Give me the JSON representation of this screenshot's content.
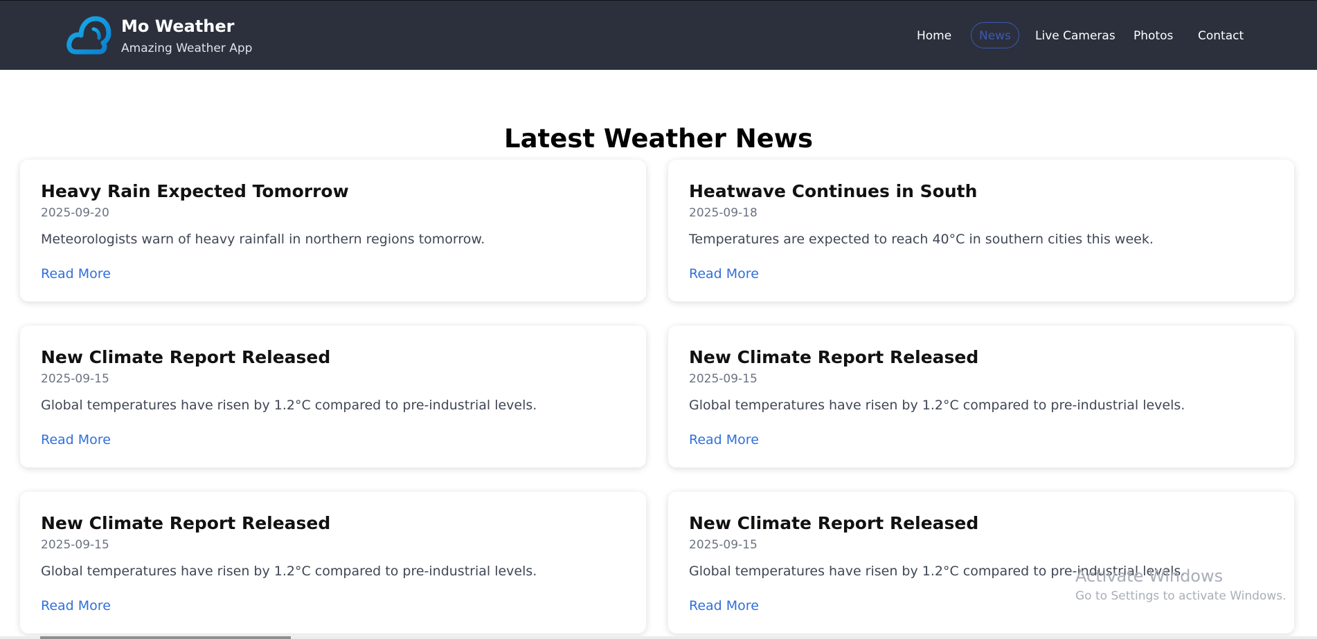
{
  "header": {
    "brand_title": "Mo Weather",
    "brand_subtitle": "Amazing Weather App",
    "logo_icon": "cloud-icon",
    "nav": [
      {
        "label": "Home",
        "active": false
      },
      {
        "label": "News",
        "active": true
      },
      {
        "label": "Live Cameras",
        "active": false
      },
      {
        "label": "Photos",
        "active": false
      },
      {
        "label": "Contact",
        "active": false
      }
    ]
  },
  "main": {
    "heading": "Latest Weather News",
    "articles": [
      {
        "title": "Heavy Rain Expected Tomorrow",
        "date": "2025-09-20",
        "summary": "Meteorologists warn of heavy rainfall in northern regions tomorrow.",
        "link": "Read More"
      },
      {
        "title": "Heatwave Continues in South",
        "date": "2025-09-18",
        "summary": "Temperatures are expected to reach 40°C in southern cities this week.",
        "link": "Read More"
      },
      {
        "title": "New Climate Report Released",
        "date": "2025-09-15",
        "summary": "Global temperatures have risen by 1.2°C compared to pre-industrial levels.",
        "link": "Read More"
      },
      {
        "title": "New Climate Report Released",
        "date": "2025-09-15",
        "summary": "Global temperatures have risen by 1.2°C compared to pre-industrial levels.",
        "link": "Read More"
      },
      {
        "title": "New Climate Report Released",
        "date": "2025-09-15",
        "summary": "Global temperatures have risen by 1.2°C compared to pre-industrial levels.",
        "link": "Read More"
      },
      {
        "title": "New Climate Report Released",
        "date": "2025-09-15",
        "summary": "Global temperatures have risen by 1.2°C compared to pre-industrial levels.",
        "link": "Read More"
      }
    ]
  },
  "overlay": {
    "watermark_title": "Activate Windows",
    "watermark_subtitle": "Go to Settings to activate Windows."
  },
  "colors": {
    "navbar_bg": "#2b303c",
    "active_nav": "#3f58b5",
    "link": "#2f6fdb",
    "logo_gradient_start": "#15a8e7",
    "logo_gradient_end": "#0d7fd0"
  }
}
